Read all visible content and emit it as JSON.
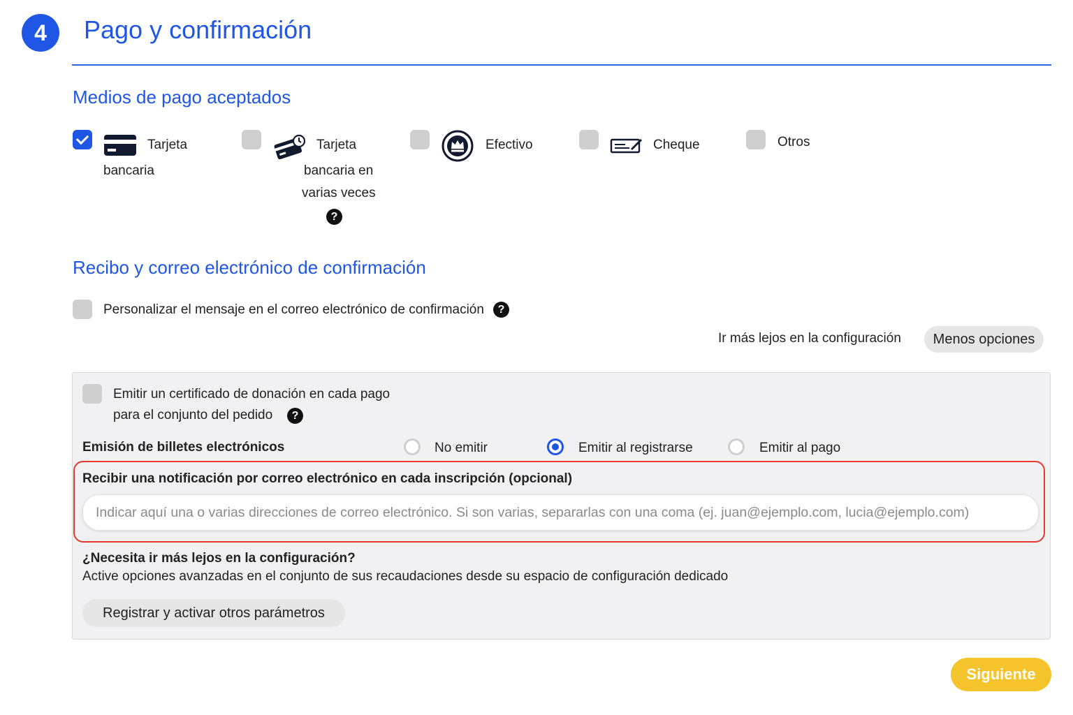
{
  "step": {
    "number": "4",
    "title": "Pago y confirmación"
  },
  "colors": {
    "accent": "#1f56e6",
    "highlight": "#e63a2e",
    "next_button": "#f5c42c"
  },
  "payment": {
    "title": "Medios de pago aceptados",
    "methods": [
      {
        "label_line1": "Tarjeta",
        "label_line2": "bancaria",
        "checked": true,
        "icon": "credit-card-icon"
      },
      {
        "label_line1": "Tarjeta",
        "label_line2": "bancaria en",
        "label_line3": "varias veces",
        "checked": false,
        "icon": "card-installments-icon",
        "help": "?"
      },
      {
        "label": "Efectivo",
        "checked": false,
        "icon": "cash-crown-icon"
      },
      {
        "label": "Cheque",
        "checked": false,
        "icon": "cheque-icon"
      },
      {
        "label": "Otros",
        "checked": false
      }
    ]
  },
  "receipt": {
    "title": "Recibo y correo electrónico de confirmación",
    "customize_label": "Personalizar el mensaje en el correo electrónico de confirmación",
    "help": "?",
    "further_config_label": "Ir más lejos en la configuración",
    "less_options_button": "Menos opciones"
  },
  "advanced": {
    "certificate_line1": "Emitir un certificado de donación en cada pago",
    "certificate_line2": "para el conjunto del pedido",
    "help": "?",
    "tickets_label": "Emisión de billetes electrónicos",
    "ticket_options": [
      {
        "label": "No emitir",
        "selected": false
      },
      {
        "label": "Emitir al registrarse",
        "selected": true
      },
      {
        "label": "Emitir al pago",
        "selected": false
      }
    ],
    "notification_label": "Recibir una notificación por correo electrónico en cada inscripción (opcional)",
    "notification_placeholder": "Indicar aquí una o varias direcciones de correo electrónico. Si son varias, separarlas con una coma (ej. juan@ejemplo.com, lucia@ejemplo.com)",
    "more_title": "¿Necesita ir más lejos en la configuración?",
    "more_desc": "Active opciones avanzadas en el conjunto de sus recaudaciones desde su espacio de configuración dedicado",
    "register_button": "Registrar y activar otros parámetros"
  },
  "next_button": "Siguiente"
}
